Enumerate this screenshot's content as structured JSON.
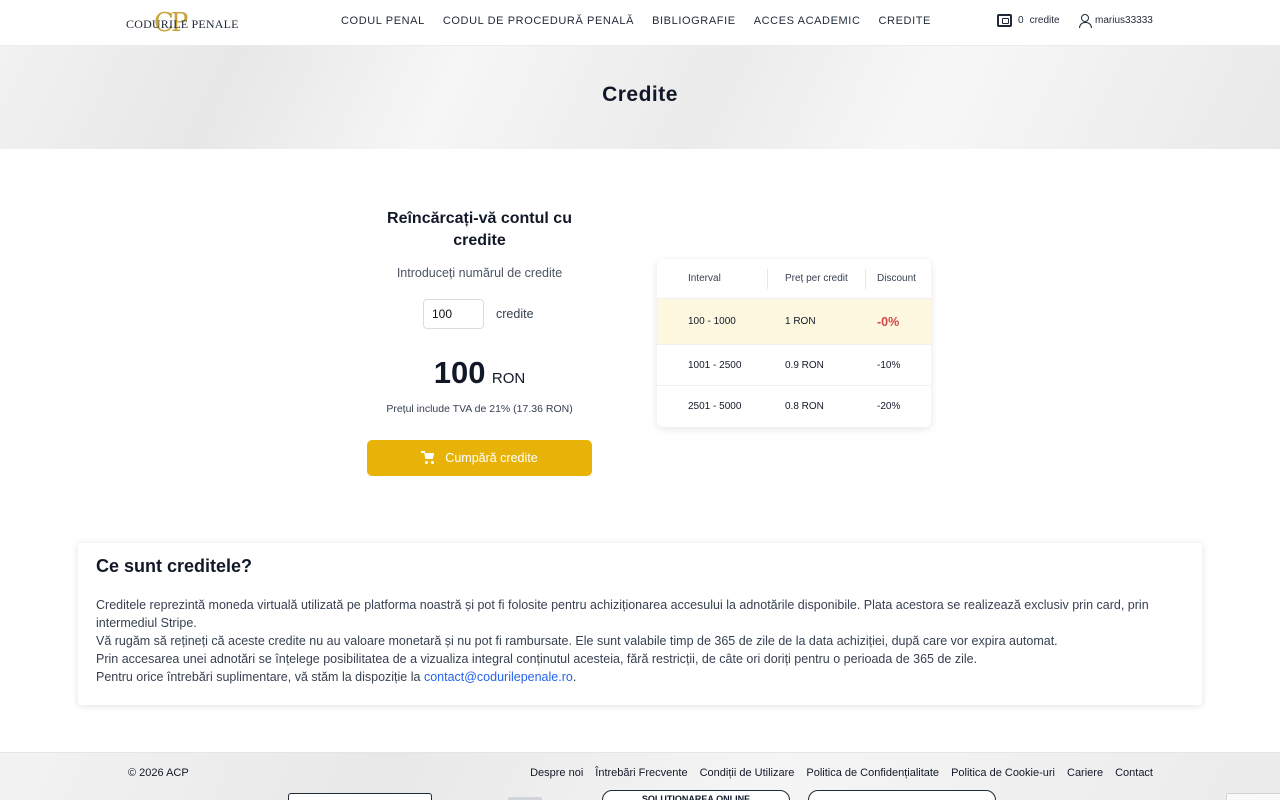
{
  "header": {
    "logo_monogram": "CP",
    "logo_text": "CODURILE PENALE",
    "nav": [
      "CODUL PENAL",
      "CODUL DE PROCEDURĂ PENALĂ",
      "BIBLIOGRAFIE",
      "ACCES ACADEMIC",
      "CREDITE"
    ],
    "credits_count": "0",
    "credits_label": "credite",
    "username": "marius33333"
  },
  "hero": {
    "title": "Credite"
  },
  "purchase": {
    "heading": "Reîncărcați-vă contul cu credite",
    "hint": "Introduceți numărul de credite",
    "quantity_value": "100",
    "quantity_unit": "credite",
    "price_amount": "100",
    "price_currency": "RON",
    "vat_note": "Prețul include TVA de 21% (17.36 RON)",
    "buy_label": "Cumpără credite"
  },
  "pricing_table": {
    "headers": [
      "Interval",
      "Preț per credit",
      "Discount"
    ],
    "rows": [
      {
        "interval": "100 - 1000",
        "price": "1 RON",
        "discount": "-0%"
      },
      {
        "interval": "1001 - 2500",
        "price": "0.9 RON",
        "discount": "-10%"
      },
      {
        "interval": "2501 - 5000",
        "price": "0.8 RON",
        "discount": "-20%"
      }
    ]
  },
  "info": {
    "title": "Ce sunt creditele?",
    "p1": "Creditele reprezintă moneda virtuală utilizată pe platforma noastră și pot fi folosite pentru achiziționarea accesului la adnotările disponibile. Plata acestora se realizează exclusiv prin card, prin intermediul Stripe.",
    "p2": "Vă rugăm să rețineți că aceste credite nu au valoare monetară și nu pot fi rambursate. Ele sunt valabile timp de 365 de zile de la data achiziției, după care vor expira automat.",
    "p3": "Prin accesarea unei adnotări se înțelege posibilitatea de a vizualiza integral conținutul acesteia, fără restricții, de câte ori doriți pentru o perioada de 365 de zile.",
    "p4_prefix": "Pentru orice întrebări suplimentare, vă stăm la dispoziție la ",
    "email": "contact@codurilepenale.ro",
    "p4_suffix": "."
  },
  "footer": {
    "copyright": "© 2026 ACP",
    "links": [
      "Despre noi",
      "Întrebări Frecvente",
      "Condiții de Utilizare",
      "Politica de Confidențialitate",
      "Politica de Cookie-uri",
      "Cariere",
      "Contact"
    ],
    "badge_text": "SOLUȚIONAREA ONLINE"
  },
  "colors": {
    "accent": "#e8b309",
    "discount_red": "#d64545",
    "highlight_row": "#fdf8df",
    "link": "#2563eb"
  }
}
